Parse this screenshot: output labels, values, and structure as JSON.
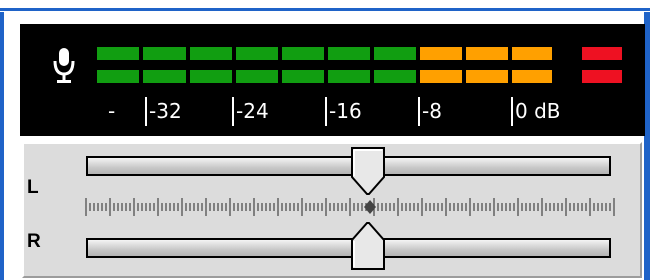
{
  "meter": {
    "db_scale": [
      "-",
      "-32",
      "-24",
      "-16",
      "-8",
      "0 dB"
    ],
    "segment_colors": {
      "green": "#119e11",
      "orange": "#ffa000",
      "red": "#ee1122"
    },
    "mic_icon": "microphone-icon"
  },
  "gain": {
    "left_label": "L",
    "right_label": "R",
    "left_slider_value": 0.5,
    "right_slider_value": 0.5
  },
  "colors": {
    "window_blue": "#1f63c8",
    "meter_background": "#000000",
    "panel_background": "#dcdcdc"
  }
}
